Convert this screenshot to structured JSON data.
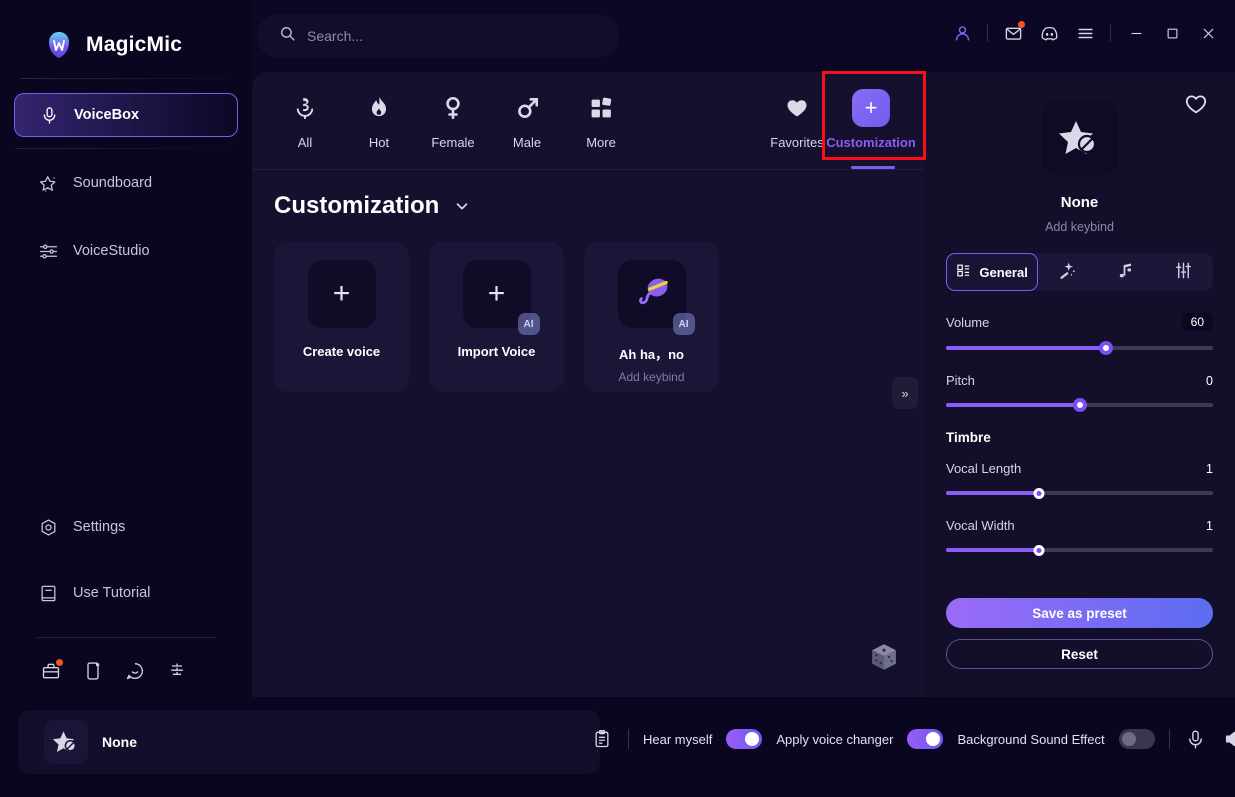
{
  "app": {
    "brand": "MagicMic",
    "logo_icon": "magicmic-logo-icon"
  },
  "search": {
    "placeholder": "Search...",
    "value": "",
    "icon": "search-icon"
  },
  "titlebar": {
    "icons": [
      {
        "name": "account-icon",
        "glyph": "person"
      },
      {
        "name": "mail-icon",
        "glyph": "mail",
        "badge": true
      },
      {
        "name": "discord-icon",
        "glyph": "discord"
      },
      {
        "name": "menu-icon",
        "glyph": "hamburger"
      }
    ],
    "window_controls": [
      {
        "name": "minimize-button",
        "glyph": "minimize"
      },
      {
        "name": "maximize-button",
        "glyph": "maximize"
      },
      {
        "name": "close-button",
        "glyph": "close"
      }
    ]
  },
  "sidebar": {
    "items": [
      {
        "label": "VoiceBox",
        "icon": "microphone-icon",
        "active": true
      },
      {
        "label": "Soundboard",
        "icon": "sparkle-star-icon",
        "active": false
      },
      {
        "label": "VoiceStudio",
        "icon": "equalizer-icon",
        "active": false
      }
    ],
    "lower_items": [
      {
        "label": "Settings",
        "icon": "gear-icon"
      },
      {
        "label": "Use Tutorial",
        "icon": "book-icon"
      }
    ],
    "social_icons": [
      {
        "name": "toolbox-icon",
        "badge": true
      },
      {
        "name": "mobile-device-icon",
        "badge": false
      },
      {
        "name": "chat-bubble-icon",
        "badge": false
      },
      {
        "name": "feedback-icon",
        "badge": false
      }
    ]
  },
  "tabs": [
    {
      "label": "All",
      "icon": "microphone-all-icon",
      "active": false
    },
    {
      "label": "Hot",
      "icon": "flame-icon",
      "active": false
    },
    {
      "label": "Female",
      "icon": "female-symbol-icon",
      "active": false
    },
    {
      "label": "Male",
      "icon": "male-symbol-icon",
      "active": false
    },
    {
      "label": "More",
      "icon": "grid-more-icon",
      "active": false
    },
    {
      "label": "Favorites",
      "icon": "heart-icon",
      "active": false
    },
    {
      "label": "Customization",
      "icon": "plus-tile-icon",
      "active": true
    }
  ],
  "section": {
    "title": "Customization",
    "chevron_icon": "chevron-down-icon"
  },
  "cards": [
    {
      "title": "Create voice",
      "subtitle": "",
      "thumb": "plus-icon",
      "ai": false
    },
    {
      "title": "Import Voice",
      "subtitle": "",
      "thumb": "plus-icon",
      "ai": true,
      "ai_label": "AI"
    },
    {
      "title": "Ah ha，no",
      "subtitle": "Add keybind",
      "thumb": "purple-microphone-avatar",
      "ai": true,
      "ai_label": "AI"
    }
  ],
  "main_extras": {
    "collapse_icon": "double-chevron-right-icon",
    "dice_icon": "dice-icon"
  },
  "right_panel": {
    "favorite_icon": "heart-outline-icon",
    "voice_name": "None",
    "voice_sub": "Add keybind",
    "voice_thumb_icon": "star-none-icon",
    "segments": [
      {
        "label": "General",
        "icon": "grid-general-icon",
        "active": true
      },
      {
        "label": "",
        "icon": "magic-wand-icon",
        "active": false
      },
      {
        "label": "",
        "icon": "music-note-icon",
        "active": false
      },
      {
        "label": "",
        "icon": "sliders-icon",
        "active": false
      }
    ],
    "controls": [
      {
        "label": "Volume",
        "value": "60",
        "percent": 60,
        "boxed": true,
        "style": "large"
      },
      {
        "label": "Pitch",
        "value": "0",
        "percent": 50,
        "boxed": false,
        "style": "large"
      }
    ],
    "timbre_title": "Timbre",
    "timbre_controls": [
      {
        "label": "Vocal Length",
        "value": "1",
        "percent": 35,
        "style": "small"
      },
      {
        "label": "Vocal Width",
        "value": "1",
        "percent": 35,
        "style": "small"
      }
    ],
    "save_label": "Save as preset",
    "reset_label": "Reset"
  },
  "bottom": {
    "now_playing_name": "None",
    "now_playing_icon": "star-none-icon",
    "clipboard_icon": "clipboard-icon",
    "toggles": [
      {
        "label": "Hear myself",
        "on": true
      },
      {
        "label": "Apply voice changer",
        "on": true
      },
      {
        "label": "Background Sound Effect",
        "on": false
      }
    ],
    "mic_icon": "microphone-icon",
    "speaker_icon": "speaker-icon"
  },
  "colors": {
    "accent": "#7c5cf5",
    "accent_text": "#8b5cf6",
    "highlight_box": "#fc0d1b",
    "background": "#0b0724",
    "panel": "#14102e",
    "badge_red": "#f4541f"
  }
}
